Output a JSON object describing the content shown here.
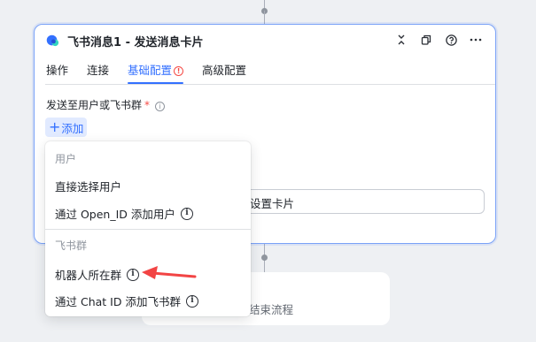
{
  "card": {
    "title": "飞书消息1 - 发送消息卡片",
    "header_icons": [
      "collapse-icon",
      "copy-icon",
      "help-icon",
      "more-icon"
    ]
  },
  "tabs": [
    {
      "label": "操作",
      "active": false
    },
    {
      "label": "连接",
      "active": false
    },
    {
      "label": "基础配置",
      "active": true,
      "warning": "!"
    },
    {
      "label": "高级配置",
      "active": false
    }
  ],
  "field": {
    "label": "发送至用户或飞书群",
    "required_mark": "*",
    "info": "i"
  },
  "add_button": {
    "plus": "+",
    "label": "添加"
  },
  "card_input": {
    "value": "设置卡片"
  },
  "end_node": {
    "label": "结束流程"
  },
  "dropdown": {
    "groups": [
      {
        "label": "用户",
        "items": [
          {
            "label": "直接选择用户",
            "info": false
          },
          {
            "label": "通过 Open_ID 添加用户",
            "info": true
          }
        ]
      },
      {
        "label": "飞书群",
        "items": [
          {
            "label": "机器人所在群",
            "info": true
          },
          {
            "label": "通过 Chat ID 添加飞书群",
            "info": true
          }
        ]
      }
    ],
    "info_glyph": "i"
  },
  "colors": {
    "accent": "#3370ff",
    "required": "#f54a45",
    "annotation_arrow": "#f24444",
    "card_border": "#7aa2f7",
    "background": "#eef0f3"
  }
}
